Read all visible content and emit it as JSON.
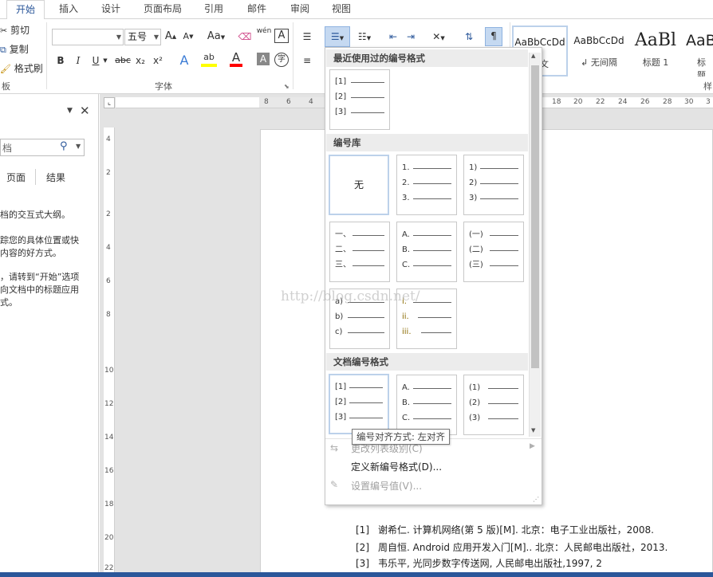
{
  "tabs": [
    {
      "label": "开始",
      "active": true
    },
    {
      "label": "插入"
    },
    {
      "label": "设计"
    },
    {
      "label": "页面布局"
    },
    {
      "label": "引用"
    },
    {
      "label": "邮件"
    },
    {
      "label": "审阅"
    },
    {
      "label": "视图"
    }
  ],
  "clipboard": {
    "cut": "剪切",
    "copy": "复制",
    "painter": "格式刷",
    "group": "板"
  },
  "font": {
    "font_name": "",
    "font_size": "五号",
    "grow": "A",
    "shrink": "A",
    "case": "Aa",
    "phonetic": "wén",
    "group": "字体",
    "bold": "B",
    "italic": "I",
    "underline": "U",
    "strike": "abc",
    "sub": "x₂",
    "sup": "x²",
    "effects": "A",
    "highlight": "ab",
    "color": "A",
    "shade": "A",
    "enclose": "字"
  },
  "styles": {
    "items": [
      {
        "preview": "AaBbCcDd",
        "name": "正文"
      },
      {
        "preview": "AaBbCcDd",
        "name": "↲ 无间隔"
      },
      {
        "preview": "AaBl",
        "name": "标题 1"
      },
      {
        "preview": "AaB",
        "name": "标题"
      }
    ],
    "group": "样"
  },
  "nav": {
    "search_placeholder": "档",
    "tabs": [
      "页面",
      "结果"
    ],
    "text": [
      "档的交互式大纲。",
      "踪您的具体位置或快",
      "内容的好方式。",
      "，请转到“开始”选项",
      "向文档中的标题应用",
      "式。"
    ]
  },
  "ruler": {
    "h": [
      "8",
      "6",
      "4",
      "18",
      "20",
      "22",
      "24",
      "26",
      "28",
      "30",
      "3"
    ],
    "v": [
      "4",
      "2",
      "2",
      "4",
      "6",
      "8",
      "10",
      "12",
      "14",
      "16",
      "18",
      "20",
      "22"
    ]
  },
  "dropdown": {
    "recent_header": "最近使用过的编号格式",
    "library_header": "编号库",
    "document_header": "文档编号格式",
    "none_label": "无",
    "recent": [
      [
        "[1]",
        "[2]",
        "[3]"
      ]
    ],
    "library": [
      [
        "1.",
        "2.",
        "3."
      ],
      [
        "1)",
        "2)",
        "3)"
      ],
      [
        "一、",
        "二、",
        "三、"
      ],
      [
        "A.",
        "B.",
        "C."
      ],
      [
        "(一)",
        "(二)",
        "(三)"
      ],
      [
        "a)",
        "b)",
        "c)"
      ],
      [
        "i.",
        "ii.",
        "iii."
      ]
    ],
    "document": [
      [
        "[1]",
        "[2]",
        "[3]"
      ],
      [
        "A.",
        "B.",
        "C."
      ],
      [
        "(1)",
        "(2)",
        "(3)"
      ]
    ],
    "menu": {
      "change_level": "更改列表级别(C)",
      "define_new": "定义新编号格式(D)...",
      "set_value": "设置编号值(V)..."
    }
  },
  "tooltip": "编号对齐方式: 左对齐",
  "watermark": "http://blog.csdn.net/",
  "references": [
    {
      "num": "[1]",
      "text": "谢希仁. 计算机网络(第 5 版)[M]. 北京：电子工业出版社，2008."
    },
    {
      "num": "[2]",
      "text": "周自恒. Android 应用开发入门[M].. 北京：人民邮电出版社，2013."
    },
    {
      "num": "[3]",
      "text": "韦乐平, 光同步数字传送网, 人民邮电出版社,1997, 2"
    }
  ],
  "colors": {
    "accent": "#2b579a",
    "highlight": "#ffff00",
    "font_color": "#ff0000",
    "active_btn": "#c5d9f1"
  }
}
